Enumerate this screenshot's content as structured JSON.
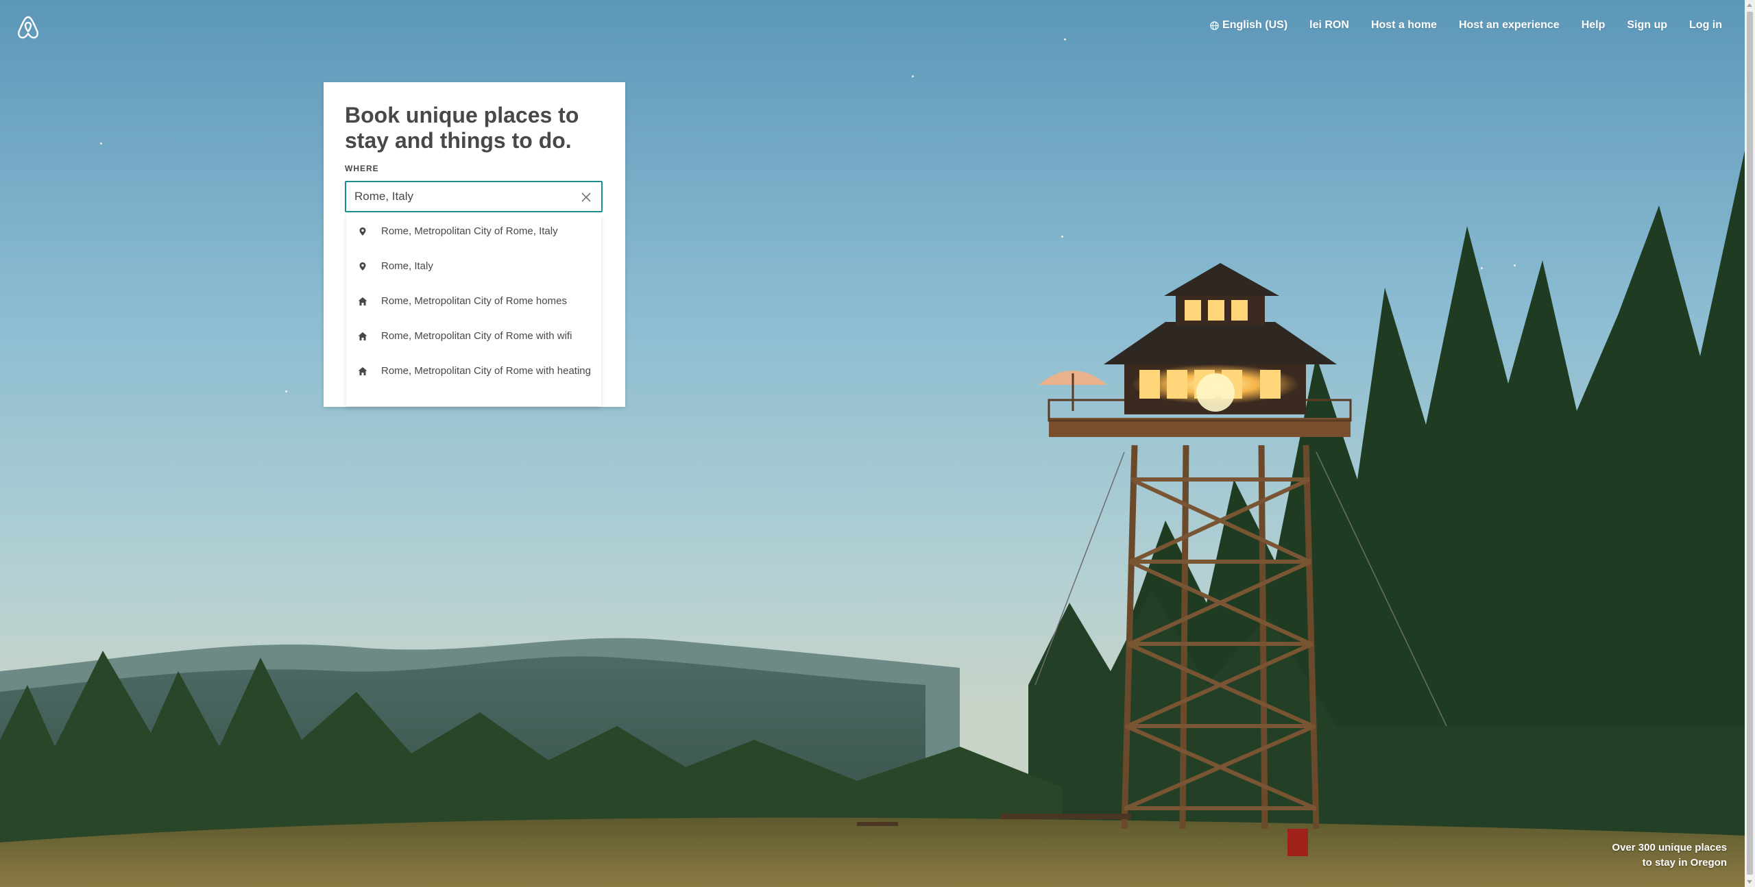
{
  "header": {
    "logo": "airbnb-logo",
    "nav": [
      {
        "label": "English (US)",
        "icon": "globe-icon"
      },
      {
        "label": "lei RON"
      },
      {
        "label": "Host a home"
      },
      {
        "label": "Host an experience"
      },
      {
        "label": "Help"
      },
      {
        "label": "Sign up"
      },
      {
        "label": "Log in"
      }
    ]
  },
  "search": {
    "title": "Book unique places to stay and things to do.",
    "where_label": "WHERE",
    "where_value": "Rome, Italy",
    "suggestions": [
      {
        "label": "Rome, Metropolitan City of Rome, Italy",
        "icon": "map-pin-icon"
      },
      {
        "label": "Rome, Italy",
        "icon": "map-pin-icon"
      },
      {
        "label": "Rome, Metropolitan City of Rome homes",
        "icon": "home-icon"
      },
      {
        "label": "Rome, Metropolitan City of Rome with wifi",
        "icon": "home-icon"
      },
      {
        "label": "Rome, Metropolitan City of Rome with heating",
        "icon": "home-icon"
      }
    ]
  },
  "caption": {
    "line1": "Over 300 unique places",
    "line2": "to stay in Oregon"
  },
  "colors": {
    "accent": "#1a8e8c",
    "text": "#484848",
    "brand": "#ffffff"
  }
}
